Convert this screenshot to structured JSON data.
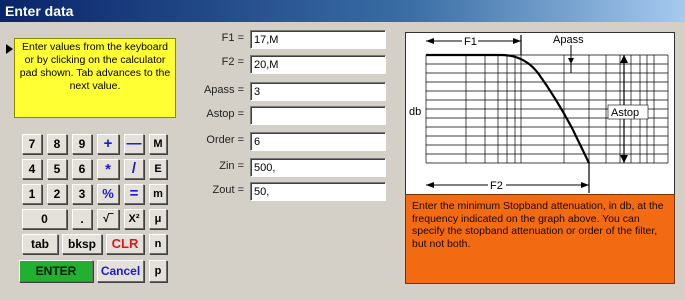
{
  "window": {
    "title": "Enter data"
  },
  "hint": {
    "text": "Enter values from the keyboard or by clicking on the calculator pad shown. Tab advances to the next value."
  },
  "keypad": {
    "rows": [
      [
        "7",
        "8",
        "9",
        "+",
        "—",
        "M"
      ],
      [
        "4",
        "5",
        "6",
        "*",
        "/",
        "E"
      ],
      [
        "1",
        "2",
        "3",
        "%",
        "=",
        "m"
      ],
      [
        "0",
        ".",
        "√‾",
        "X²",
        "μ"
      ],
      [
        "tab",
        "bksp",
        "CLR",
        "n"
      ],
      [
        "ENTER",
        "Cancel",
        "p"
      ]
    ]
  },
  "fields": [
    {
      "label": "F1 =",
      "value": "17,M"
    },
    {
      "label": "F2 =",
      "value": "20,M"
    },
    {
      "label": "Apass =",
      "value": "3"
    },
    {
      "label": "Astop =",
      "value": ""
    },
    {
      "label": "Order =",
      "value": "6"
    },
    {
      "label": "Zin =",
      "value": "500,"
    },
    {
      "label": "Zout =",
      "value": "50,"
    }
  ],
  "graph": {
    "f1_label": "F1",
    "f2_label": "F2",
    "apass_label": "Apass",
    "astop_label": "Astop",
    "db_label": "db"
  },
  "info": {
    "text": "Enter the minimum Stopband attenuation, in db, at the frequency indicated on the graph above. You can specify the stopband attenuation or order of the filter, but not both.",
    "color": "#f26a12"
  }
}
